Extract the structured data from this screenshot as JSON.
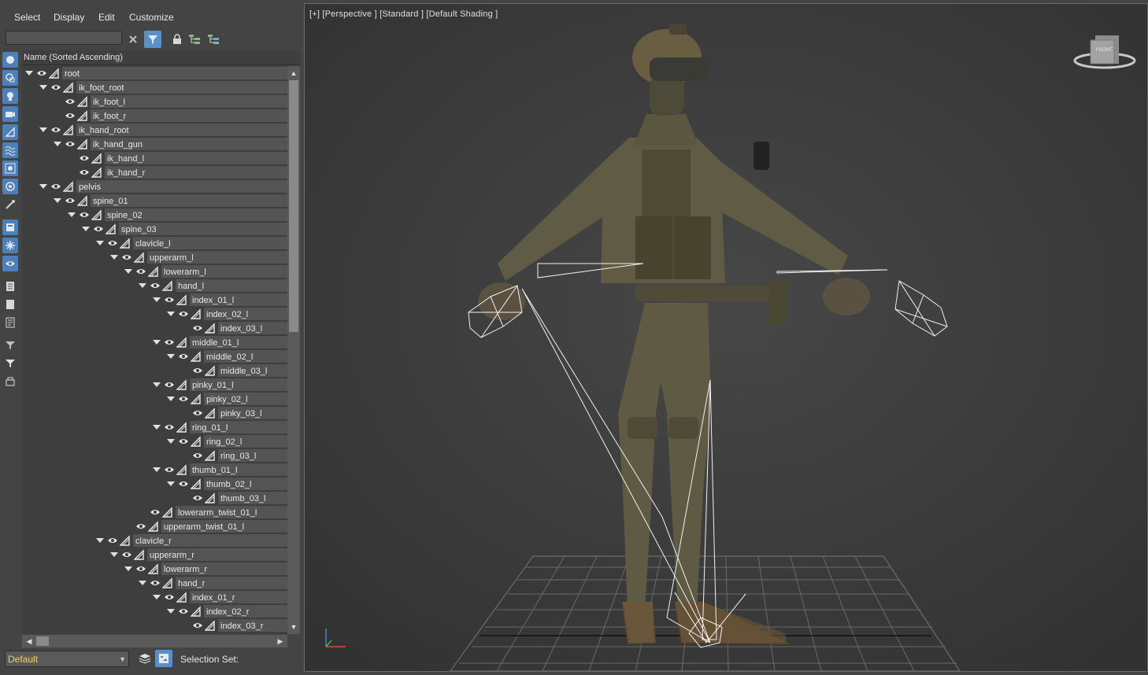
{
  "menu": [
    "Select",
    "Display",
    "Edit",
    "Customize"
  ],
  "search": {
    "value": "",
    "placeholder": ""
  },
  "tree_header": "Name (Sorted Ascending)",
  "tree": [
    {
      "name": "root",
      "depth": 0,
      "expanded": true
    },
    {
      "name": "ik_foot_root",
      "depth": 1,
      "expanded": true
    },
    {
      "name": "ik_foot_l",
      "depth": 2,
      "expanded": false
    },
    {
      "name": "ik_foot_r",
      "depth": 2,
      "expanded": false
    },
    {
      "name": "ik_hand_root",
      "depth": 1,
      "expanded": true
    },
    {
      "name": "ik_hand_gun",
      "depth": 2,
      "expanded": true
    },
    {
      "name": "ik_hand_l",
      "depth": 3,
      "expanded": false
    },
    {
      "name": "ik_hand_r",
      "depth": 3,
      "expanded": false
    },
    {
      "name": "pelvis",
      "depth": 1,
      "expanded": true
    },
    {
      "name": "spine_01",
      "depth": 2,
      "expanded": true
    },
    {
      "name": "spine_02",
      "depth": 3,
      "expanded": true
    },
    {
      "name": "spine_03",
      "depth": 4,
      "expanded": true
    },
    {
      "name": "clavicle_l",
      "depth": 5,
      "expanded": true
    },
    {
      "name": "upperarm_l",
      "depth": 6,
      "expanded": true
    },
    {
      "name": "lowerarm_l",
      "depth": 7,
      "expanded": true
    },
    {
      "name": "hand_l",
      "depth": 8,
      "expanded": true
    },
    {
      "name": "index_01_l",
      "depth": 9,
      "expanded": true
    },
    {
      "name": "index_02_l",
      "depth": 10,
      "expanded": true
    },
    {
      "name": "index_03_l",
      "depth": 11,
      "expanded": false
    },
    {
      "name": "middle_01_l",
      "depth": 9,
      "expanded": true
    },
    {
      "name": "middle_02_l",
      "depth": 10,
      "expanded": true
    },
    {
      "name": "middle_03_l",
      "depth": 11,
      "expanded": false
    },
    {
      "name": "pinky_01_l",
      "depth": 9,
      "expanded": true
    },
    {
      "name": "pinky_02_l",
      "depth": 10,
      "expanded": true
    },
    {
      "name": "pinky_03_l",
      "depth": 11,
      "expanded": false
    },
    {
      "name": "ring_01_l",
      "depth": 9,
      "expanded": true
    },
    {
      "name": "ring_02_l",
      "depth": 10,
      "expanded": true
    },
    {
      "name": "ring_03_l",
      "depth": 11,
      "expanded": false
    },
    {
      "name": "thumb_01_l",
      "depth": 9,
      "expanded": true
    },
    {
      "name": "thumb_02_l",
      "depth": 10,
      "expanded": true
    },
    {
      "name": "thumb_03_l",
      "depth": 11,
      "expanded": false
    },
    {
      "name": "lowerarm_twist_01_l",
      "depth": 8,
      "expanded": false
    },
    {
      "name": "upperarm_twist_01_l",
      "depth": 7,
      "expanded": false
    },
    {
      "name": "clavicle_r",
      "depth": 5,
      "expanded": true
    },
    {
      "name": "upperarm_r",
      "depth": 6,
      "expanded": true
    },
    {
      "name": "lowerarm_r",
      "depth": 7,
      "expanded": true
    },
    {
      "name": "hand_r",
      "depth": 8,
      "expanded": true
    },
    {
      "name": "index_01_r",
      "depth": 9,
      "expanded": true
    },
    {
      "name": "index_02_r",
      "depth": 10,
      "expanded": true
    },
    {
      "name": "index_03_r",
      "depth": 11,
      "expanded": false
    }
  ],
  "bottom": {
    "layer": "Default",
    "selection_set_label": "Selection Set:"
  },
  "viewport": {
    "label": "[+] [Perspective ] [Standard ] [Default Shading ]",
    "viewcube_label": "FRONT"
  },
  "colors": {
    "accent": "#5b8fc7",
    "layer_text": "#f5d44a",
    "viewport_bg": "#3a3a3a",
    "panel_bg": "#444444"
  }
}
